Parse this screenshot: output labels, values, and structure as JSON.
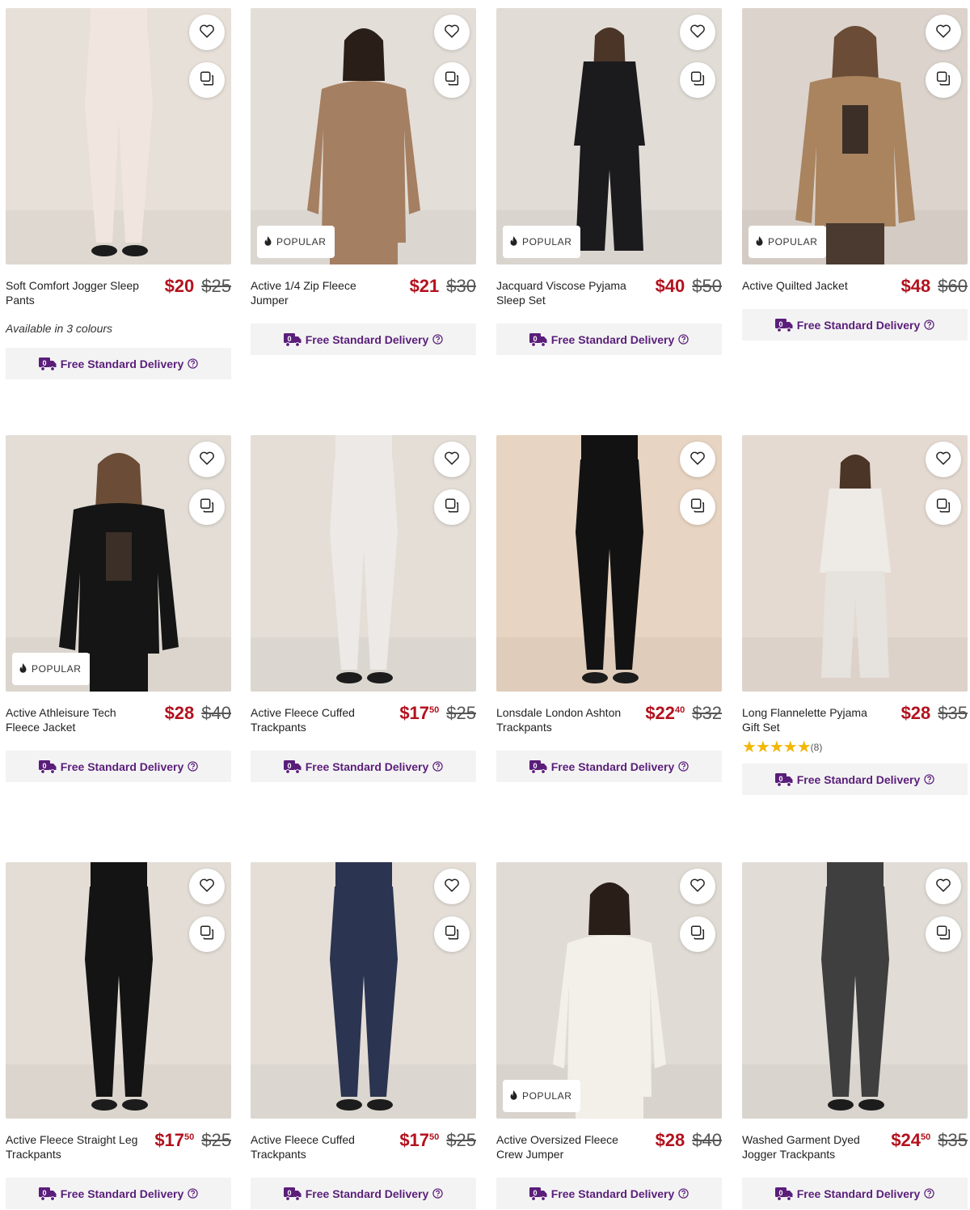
{
  "delivery_label": "Free Standard Delivery",
  "badge_label": "POPULAR",
  "products": [
    {
      "name": "Soft Comfort Jogger Sleep Pants",
      "price": "$20",
      "cents": "",
      "was": "$25",
      "popular": false,
      "colours": "Available in 3 colours",
      "rating": null,
      "reviews": "",
      "bg": "#e7e0d8",
      "look": "pants",
      "top": "#f1e6df",
      "bottom": "#f1e6df"
    },
    {
      "name": "Active 1/4 Zip Fleece Jumper",
      "price": "$21",
      "cents": "",
      "was": "$30",
      "popular": true,
      "colours": "",
      "rating": null,
      "reviews": "",
      "bg": "#e4ded8",
      "look": "jumper",
      "top": "#a57f62",
      "bottom": "#a57f62"
    },
    {
      "name": "Jacquard Viscose Pyjama Sleep Set",
      "price": "$40",
      "cents": "",
      "was": "$50",
      "popular": true,
      "colours": "",
      "rating": null,
      "reviews": "",
      "bg": "#e1dcd6",
      "look": "full",
      "top": "#1b1b1e",
      "bottom": "#1b1b1e"
    },
    {
      "name": "Active Quilted Jacket",
      "price": "$48",
      "cents": "",
      "was": "$60",
      "popular": true,
      "colours": "",
      "rating": null,
      "reviews": "",
      "bg": "#dcd4cc",
      "look": "jacket",
      "top": "#a9845f",
      "bottom": "#4a3a30"
    },
    {
      "name": "Active Athleisure Tech Fleece Jacket",
      "price": "$28",
      "cents": "",
      "was": "$40",
      "popular": true,
      "colours": "",
      "rating": null,
      "reviews": "",
      "bg": "#e3ddd6",
      "look": "jacket",
      "top": "#151515",
      "bottom": "#151515"
    },
    {
      "name": "Active Fleece Cuffed Trackpants",
      "price": "$17",
      "cents": "50",
      "was": "$25",
      "popular": false,
      "colours": "",
      "rating": null,
      "reviews": "",
      "bg": "#e4ded7",
      "look": "pants",
      "top": "#ece9e6",
      "bottom": "#ece9e6"
    },
    {
      "name": "Lonsdale London Ashton Trackpants",
      "price": "$22",
      "cents": "40",
      "was": "$32",
      "popular": false,
      "colours": "",
      "rating": null,
      "reviews": "",
      "bg": "#e8d4c2",
      "look": "pants",
      "top": "#121212",
      "bottom": "#121212"
    },
    {
      "name": "Long Flannelette Pyjama Gift Set",
      "price": "$28",
      "cents": "",
      "was": "$35",
      "popular": false,
      "colours": "",
      "rating": 5,
      "reviews": "(8)",
      "bg": "#e5dad2",
      "look": "full",
      "top": "#eeeae6",
      "bottom": "#e6e2de"
    },
    {
      "name": "Active Fleece Straight Leg Trackpants",
      "price": "$17",
      "cents": "50",
      "was": "$25",
      "popular": false,
      "colours": "",
      "rating": null,
      "reviews": "",
      "bg": "#e3ddd6",
      "look": "pants",
      "top": "#141414",
      "bottom": "#141414"
    },
    {
      "name": "Active Fleece Cuffed Trackpants",
      "price": "$17",
      "cents": "50",
      "was": "$25",
      "popular": false,
      "colours": "",
      "rating": null,
      "reviews": "",
      "bg": "#e4ded7",
      "look": "pants",
      "top": "#2b3450",
      "bottom": "#2b3450"
    },
    {
      "name": "Active Oversized Fleece Crew Jumper",
      "price": "$28",
      "cents": "",
      "was": "$40",
      "popular": true,
      "colours": "",
      "rating": null,
      "reviews": "",
      "bg": "#e1dbd5",
      "look": "jumper",
      "top": "#f3efe9",
      "bottom": "#f3efe9"
    },
    {
      "name": "Washed Garment Dyed Jogger Trackpants",
      "price": "$24",
      "cents": "50",
      "was": "$35",
      "popular": false,
      "colours": "",
      "rating": null,
      "reviews": "",
      "bg": "#e1dcd6",
      "look": "pants",
      "top": "#3f3f3f",
      "bottom": "#3f3f3f"
    }
  ]
}
